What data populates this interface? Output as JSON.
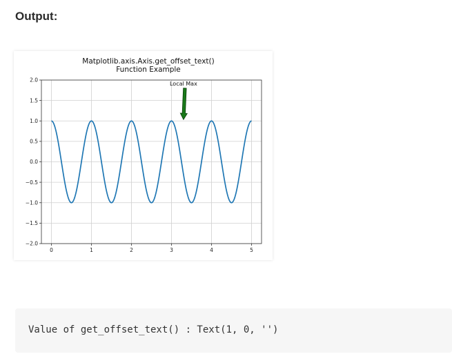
{
  "page": {
    "heading": "Output:",
    "output_text": "Value of get_offset_text() : Text(1, 0, '')"
  },
  "chart_data": {
    "type": "line",
    "title": "Matplotlib.axis.Axis.get_offset_text()",
    "subtitle": "Function Example",
    "xlabel": "",
    "ylabel": "",
    "xlim": [
      -0.25,
      5.25
    ],
    "ylim": [
      -2.0,
      2.0
    ],
    "x_ticks": [
      0,
      1,
      2,
      3,
      4,
      5
    ],
    "x_tick_labels": [
      "0",
      "1",
      "2",
      "3",
      "4",
      "5"
    ],
    "y_ticks": [
      2.0,
      1.5,
      1.0,
      0.5,
      0.0,
      -0.5,
      -1.0,
      -1.5,
      -2.0
    ],
    "y_tick_labels": [
      "2.0",
      "1.5",
      "1.0",
      "0.5",
      "0.0",
      "−0.5",
      "−1.0",
      "−1.5",
      "−2.0"
    ],
    "grid": true,
    "series": [
      {
        "function": "cos(2*pi*x)",
        "x_range": [
          0,
          5
        ],
        "color": "#1f77b4"
      }
    ],
    "annotation": {
      "text": "Local Max",
      "point": [
        3.3,
        1.0
      ],
      "text_position": [
        3.3,
        1.75
      ],
      "arrow_color": "#1a7a1a",
      "arrow_edge": "#0a3d0a"
    }
  }
}
